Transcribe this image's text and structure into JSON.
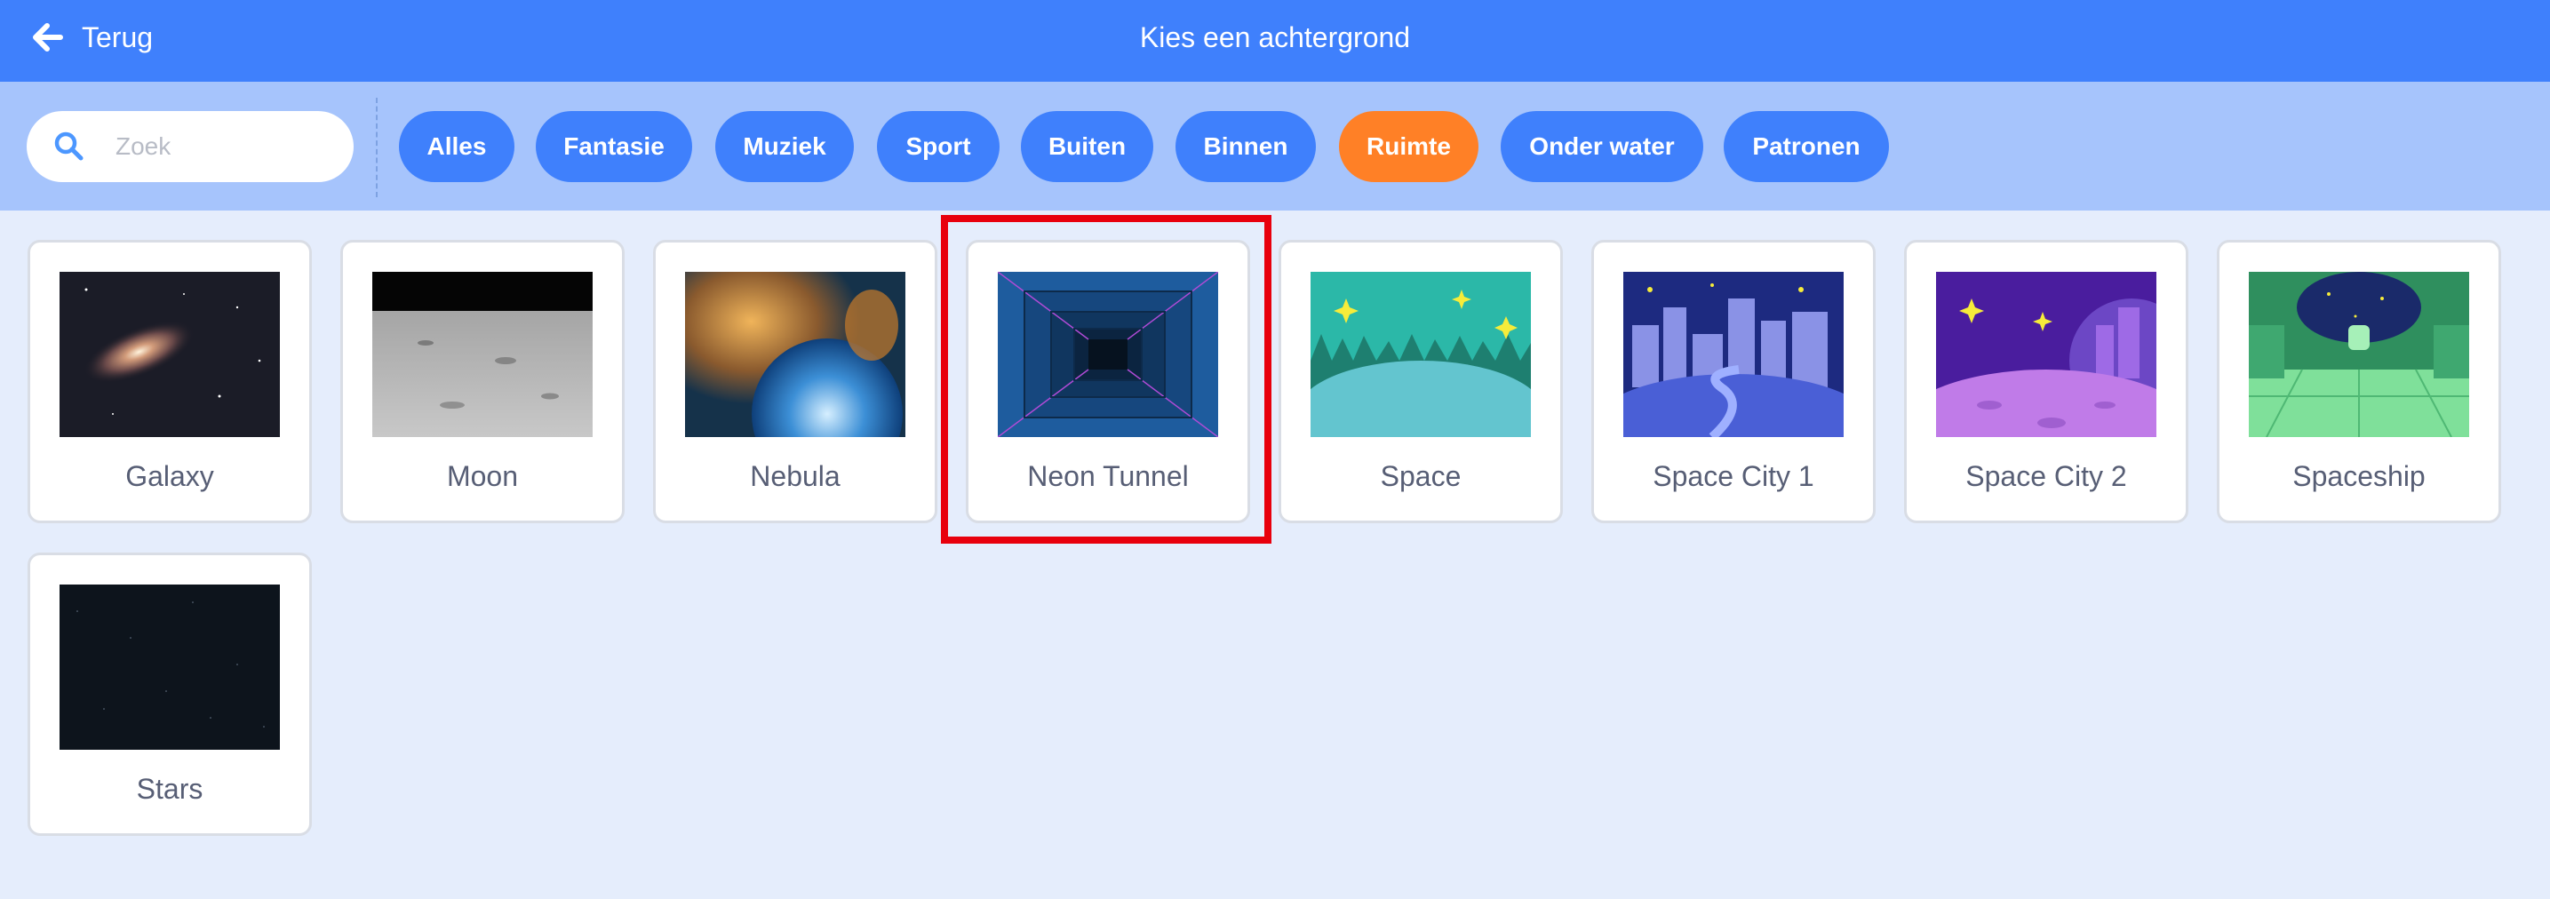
{
  "header": {
    "back_label": "Terug",
    "title": "Kies een achtergrond",
    "background": "#3f80fc"
  },
  "search": {
    "placeholder": "Zoek",
    "value": ""
  },
  "categories": [
    {
      "label": "Alles",
      "active": false
    },
    {
      "label": "Fantasie",
      "active": false
    },
    {
      "label": "Muziek",
      "active": false
    },
    {
      "label": "Sport",
      "active": false
    },
    {
      "label": "Buiten",
      "active": false
    },
    {
      "label": "Binnen",
      "active": false
    },
    {
      "label": "Ruimte",
      "active": true
    },
    {
      "label": "Onder water",
      "active": false
    },
    {
      "label": "Patronen",
      "active": false
    }
  ],
  "backdrops": [
    {
      "name": "Galaxy",
      "icon": "galaxy-thumbnail"
    },
    {
      "name": "Moon",
      "icon": "moon-thumbnail"
    },
    {
      "name": "Nebula",
      "icon": "nebula-thumbnail"
    },
    {
      "name": "Neon Tunnel",
      "icon": "neon-tunnel-thumbnail",
      "highlighted": true
    },
    {
      "name": "Space",
      "icon": "space-thumbnail"
    },
    {
      "name": "Space City 1",
      "icon": "space-city-1-thumbnail"
    },
    {
      "name": "Space City 2",
      "icon": "space-city-2-thumbnail"
    },
    {
      "name": "Spaceship",
      "icon": "spaceship-thumbnail"
    },
    {
      "name": "Stars",
      "icon": "stars-thumbnail"
    }
  ],
  "colors": {
    "accent": "#3f80fc",
    "active_chip": "#ff8026",
    "highlight": "#e8000d"
  }
}
